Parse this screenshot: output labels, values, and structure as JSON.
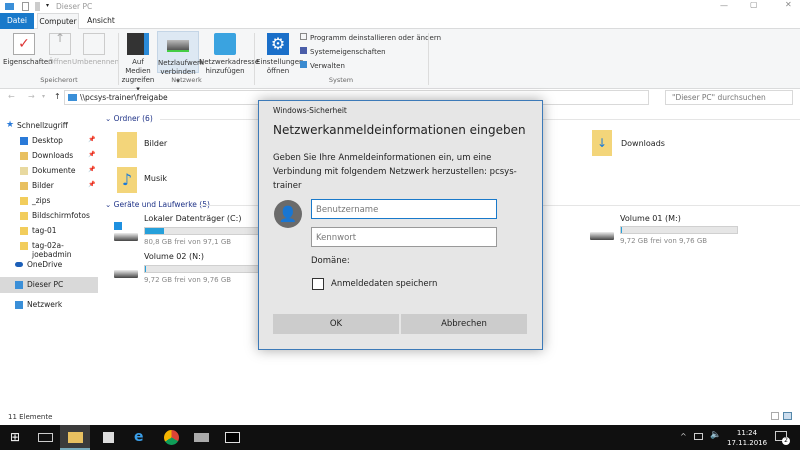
{
  "window": {
    "title": "Dieser PC"
  },
  "tabs": [
    "Datei",
    "Computer",
    "Ansicht"
  ],
  "ribbon": {
    "speicherort": {
      "label": "Speicherort",
      "buttons": [
        "Eigenschaften",
        "Öffnen",
        "Umbenennen"
      ]
    },
    "netzwerk": {
      "label": "Netzwerk",
      "buttons": [
        {
          "l1": "Auf Medien",
          "l2": "zugreifen ▾"
        },
        {
          "l1": "Netzlaufwerk",
          "l2": "verbinden ▾"
        },
        {
          "l1": "Netzwerkadresse",
          "l2": "hinzufügen"
        }
      ]
    },
    "system": {
      "label": "System",
      "settings": {
        "l1": "Einstellungen",
        "l2": "öffnen"
      },
      "items": [
        "Programm deinstallieren oder ändern",
        "Systemeigenschaften",
        "Verwalten"
      ]
    }
  },
  "address": {
    "path": "\\\\pcsys-trainer\\freigabe",
    "search_placeholder": "\"Dieser PC\" durchsuchen"
  },
  "sidebar": {
    "quick": "Schnellzugriff",
    "items": [
      "Desktop",
      "Downloads",
      "Dokumente",
      "Bilder",
      "_zips",
      "Bildschirmfotos",
      "tag-01",
      "tag-02a-joebadmin"
    ],
    "onedrive": "OneDrive",
    "thispc": "Dieser PC",
    "network": "Netzwerk"
  },
  "content": {
    "folders_header": "Ordner (6)",
    "folders": [
      "Bilder",
      "Musik",
      "Downloads"
    ],
    "drives_header": "Geräte und Laufwerke (5)",
    "drives": [
      {
        "name": "Lokaler Datenträger (C:)",
        "free": "80,8 GB frei von 97,1 GB",
        "used_pct": 17
      },
      {
        "name": "Volume 01 (M:)",
        "free": "9,72 GB frei von 9,76 GB",
        "used_pct": 0.4
      },
      {
        "name": "Volume 02 (N:)",
        "free": "9,72 GB frei von 9,76 GB",
        "used_pct": 0.4
      }
    ]
  },
  "status": {
    "count": "11 Elemente"
  },
  "dialog": {
    "title": "Windows-Sicherheit",
    "heading": "Netzwerkanmeldeinformationen eingeben",
    "text": "Geben Sie Ihre Anmeldeinformationen ein, um eine Verbindung mit folgendem Netzwerk herzustellen: pcsys-trainer",
    "user_placeholder": "Benutzername",
    "pass_placeholder": "Kennwort",
    "domain": "Domäne:",
    "remember": "Anmeldedaten speichern",
    "ok": "OK",
    "cancel": "Abbrechen"
  },
  "taskbar": {
    "time": "11:24",
    "date": "17.11.2016",
    "notifications": "2"
  }
}
